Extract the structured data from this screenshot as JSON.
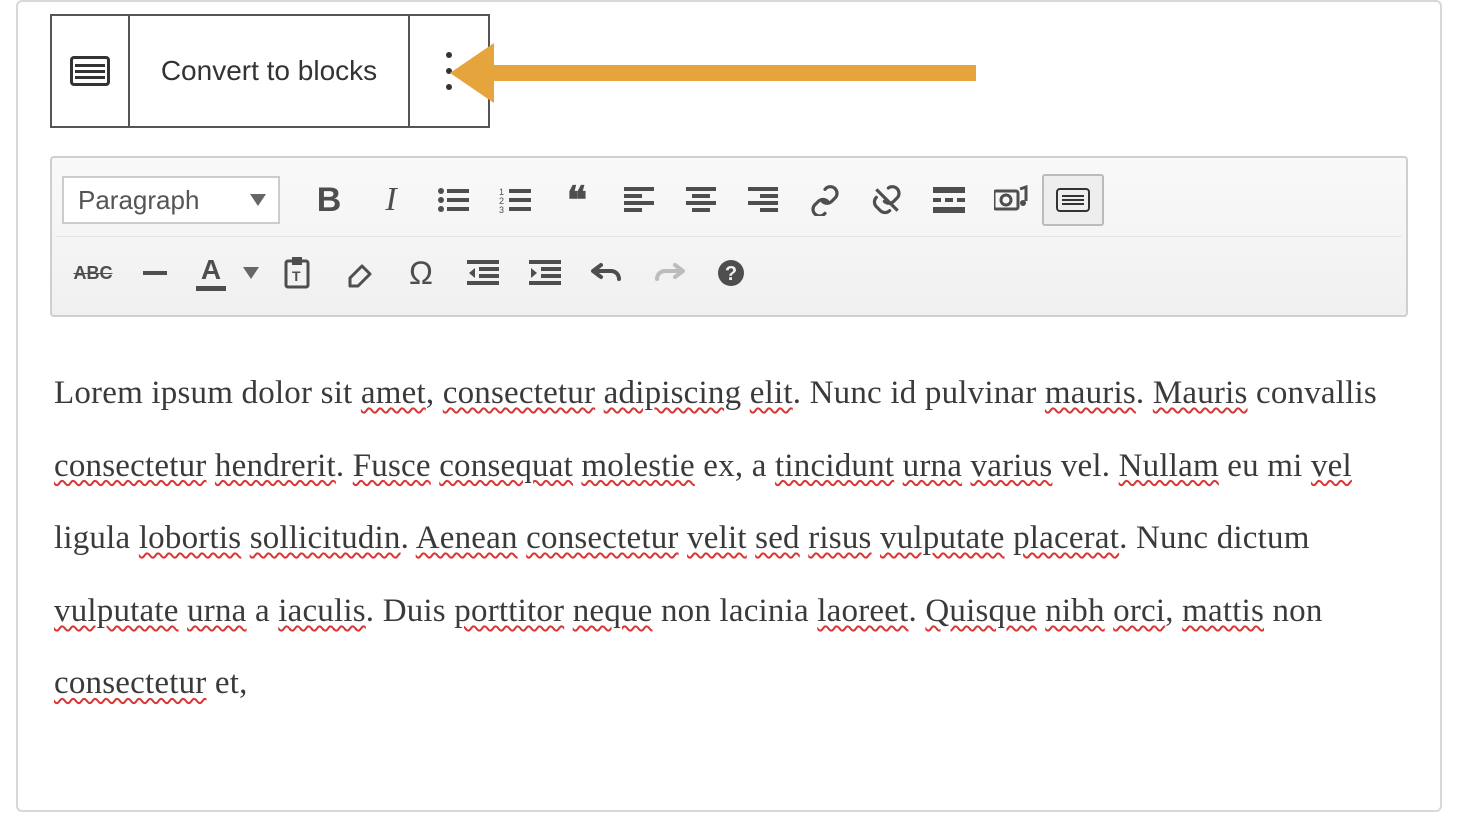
{
  "block_toolbar": {
    "convert_label": "Convert to blocks"
  },
  "format_select": {
    "value": "Paragraph"
  },
  "toolbar_icons": {
    "bold": "B",
    "italic": "I",
    "quote": "❝",
    "omega": "Ω",
    "help": "?",
    "abc": "ABC",
    "text_color_letter": "A"
  },
  "content": {
    "segments": [
      {
        "t": "Lorem ipsum dolor sit ",
        "s": false
      },
      {
        "t": "amet",
        "s": true
      },
      {
        "t": ", ",
        "s": false
      },
      {
        "t": "consectetur",
        "s": true
      },
      {
        "t": " ",
        "s": false
      },
      {
        "t": "adipiscing",
        "s": true
      },
      {
        "t": " ",
        "s": false
      },
      {
        "t": "elit",
        "s": true
      },
      {
        "t": ". Nunc id pulvinar ",
        "s": false
      },
      {
        "t": "mauris",
        "s": true
      },
      {
        "t": ". ",
        "s": false
      },
      {
        "t": "Mauris",
        "s": true
      },
      {
        "t": " convallis ",
        "s": false
      },
      {
        "t": "consectetur",
        "s": true
      },
      {
        "t": " ",
        "s": false
      },
      {
        "t": "hendrerit",
        "s": true
      },
      {
        "t": ". ",
        "s": false
      },
      {
        "t": "Fusce",
        "s": true
      },
      {
        "t": " ",
        "s": false
      },
      {
        "t": "consequat",
        "s": true
      },
      {
        "t": " ",
        "s": false
      },
      {
        "t": "molestie",
        "s": true
      },
      {
        "t": " ex, a ",
        "s": false
      },
      {
        "t": "tincidunt",
        "s": true
      },
      {
        "t": " ",
        "s": false
      },
      {
        "t": "urna",
        "s": true
      },
      {
        "t": " ",
        "s": false
      },
      {
        "t": "varius",
        "s": true
      },
      {
        "t": " vel. ",
        "s": false
      },
      {
        "t": "Nullam",
        "s": true
      },
      {
        "t": " eu mi ",
        "s": false
      },
      {
        "t": "vel",
        "s": true
      },
      {
        "t": " ligula ",
        "s": false
      },
      {
        "t": "lobortis",
        "s": true
      },
      {
        "t": " ",
        "s": false
      },
      {
        "t": "sollicitudin",
        "s": true
      },
      {
        "t": ". ",
        "s": false
      },
      {
        "t": "Aenean",
        "s": true
      },
      {
        "t": " ",
        "s": false
      },
      {
        "t": "consectetur",
        "s": true
      },
      {
        "t": " ",
        "s": false
      },
      {
        "t": "velit",
        "s": true
      },
      {
        "t": " ",
        "s": false
      },
      {
        "t": "sed",
        "s": true
      },
      {
        "t": " ",
        "s": false
      },
      {
        "t": "risus",
        "s": true
      },
      {
        "t": " ",
        "s": false
      },
      {
        "t": "vulputate",
        "s": true
      },
      {
        "t": " ",
        "s": false
      },
      {
        "t": "placerat",
        "s": true
      },
      {
        "t": ". Nunc dictum ",
        "s": false
      },
      {
        "t": "vulputate",
        "s": true
      },
      {
        "t": " ",
        "s": false
      },
      {
        "t": "urna",
        "s": true
      },
      {
        "t": " a ",
        "s": false
      },
      {
        "t": "iaculis",
        "s": true
      },
      {
        "t": ". Duis ",
        "s": false
      },
      {
        "t": "porttitor",
        "s": true
      },
      {
        "t": " ",
        "s": false
      },
      {
        "t": "neque",
        "s": true
      },
      {
        "t": " non lacinia ",
        "s": false
      },
      {
        "t": "laoreet",
        "s": true
      },
      {
        "t": ". ",
        "s": false
      },
      {
        "t": "Quisque",
        "s": true
      },
      {
        "t": " ",
        "s": false
      },
      {
        "t": "nibh",
        "s": true
      },
      {
        "t": " ",
        "s": false
      },
      {
        "t": "orci",
        "s": true
      },
      {
        "t": ", ",
        "s": false
      },
      {
        "t": "mattis",
        "s": true
      },
      {
        "t": " non ",
        "s": false
      },
      {
        "t": "consectetur",
        "s": true
      },
      {
        "t": " et,",
        "s": false
      }
    ]
  },
  "annotation": {
    "arrow_color": "#e6a43c"
  }
}
